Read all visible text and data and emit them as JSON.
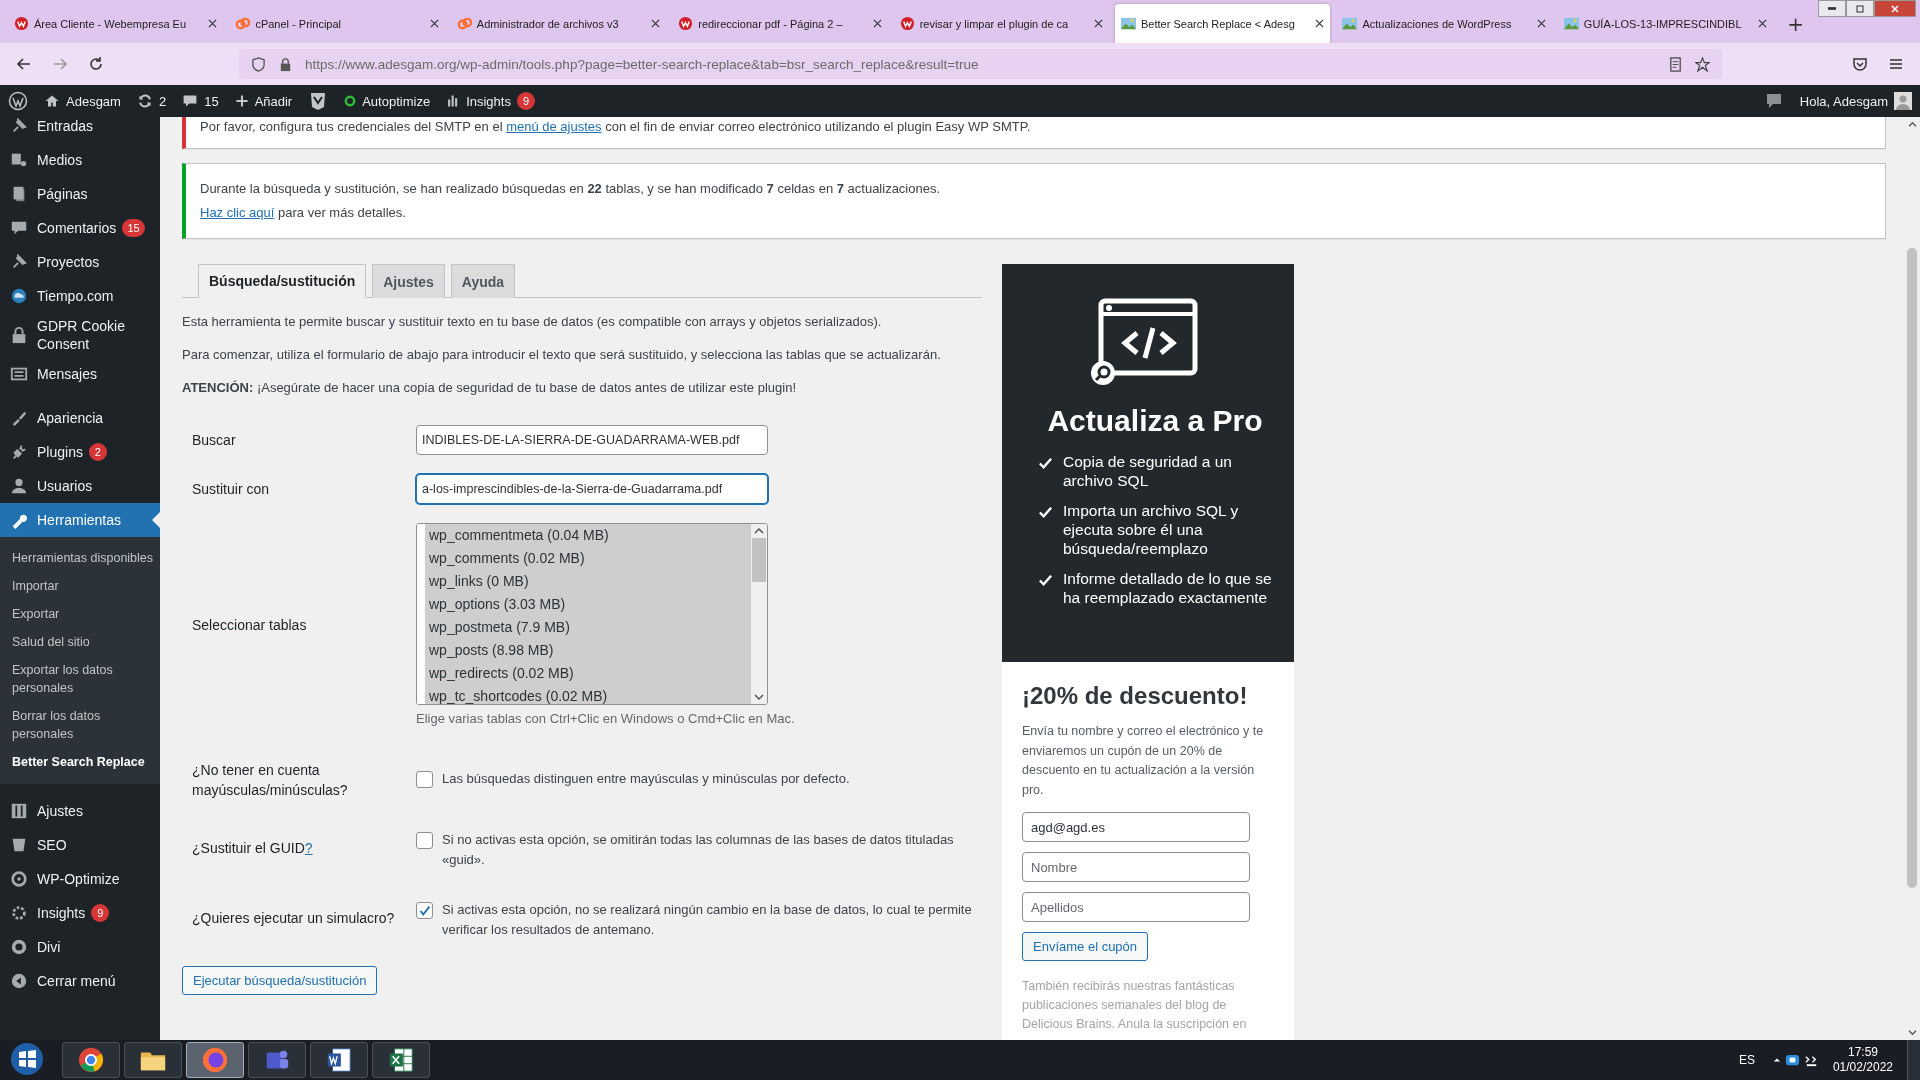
{
  "browser": {
    "tabs": [
      {
        "title": "Área Cliente - Webempresa Eu",
        "kind": "webempresa",
        "selected": false
      },
      {
        "title": "cPanel - Principal",
        "kind": "cpanel",
        "selected": false
      },
      {
        "title": "Administrador de archivos v3",
        "kind": "cpanel",
        "selected": false
      },
      {
        "title": "redireccionar pdf - Página 2 –",
        "kind": "webempresa",
        "selected": false
      },
      {
        "title": "revisar y limpar el plugin de ca",
        "kind": "webempresa",
        "selected": false
      },
      {
        "title": "Better Search Replace < Adesg",
        "kind": "image",
        "selected": true
      },
      {
        "title": "Actualizaciones de WordPress",
        "kind": "image",
        "selected": false
      },
      {
        "title": "GUÍA-LOS-13-IMPRESCINDIBL",
        "kind": "image",
        "selected": false
      }
    ],
    "new_tab": "+",
    "url": "https://www.adesgam.org/wp-admin/tools.php?page=better-search-replace&tab=bsr_search_replace&result=true"
  },
  "admin_bar": {
    "site": "Adesgam",
    "updates": "2",
    "comments": "15",
    "new": "Añadir",
    "autoptimize": "Autoptimize",
    "insights": "Insights",
    "insights_badge": "9",
    "greeting": "Hola, Adesgam"
  },
  "sidebar": {
    "items": [
      {
        "label": "Entradas",
        "selected": false
      },
      {
        "label": "Medios",
        "selected": false
      },
      {
        "label": "Páginas",
        "selected": false
      },
      {
        "label": "Comentarios",
        "badge": "15",
        "selected": false
      },
      {
        "label": "Proyectos",
        "selected": false
      },
      {
        "label": "Tiempo.com",
        "selected": false
      },
      {
        "label": "GDPR Cookie Consent",
        "selected": false
      },
      {
        "label": "Mensajes",
        "selected": false
      },
      {
        "label": "Apariencia",
        "selected": false
      },
      {
        "label": "Plugins",
        "badge": "2",
        "selected": false
      },
      {
        "label": "Usuarios",
        "selected": false
      },
      {
        "label": "Herramientas",
        "selected": true,
        "children": [
          {
            "label": "Herramientas disponibles",
            "selected": false
          },
          {
            "label": "Importar",
            "selected": false
          },
          {
            "label": "Exportar",
            "selected": false
          },
          {
            "label": "Salud del sitio",
            "selected": false
          },
          {
            "label": "Exportar los datos personales",
            "selected": false
          },
          {
            "label": "Borrar los datos personales",
            "selected": false
          },
          {
            "label": "Better Search Replace",
            "selected": true
          }
        ]
      },
      {
        "label": "Ajustes",
        "selected": false
      },
      {
        "label": "SEO",
        "selected": false
      },
      {
        "label": "WP-Optimize",
        "selected": false
      },
      {
        "label": "Insights",
        "badge": "9",
        "selected": false
      },
      {
        "label": "Divi",
        "selected": false
      },
      {
        "label": "Cerrar menú",
        "selected": false
      }
    ]
  },
  "notices": [
    {
      "kind": "error",
      "before": "Por favor, configura tus credenciales del SMTP en el ",
      "link": "menú de ajustes",
      "after": " con el fin de enviar correo electrónico utilizando el plugin Easy WP SMTP."
    },
    {
      "kind": "success",
      "text": "Durante la búsqueda y sustitución, se han realizado búsquedas en **22** tablas, y se han modificado **7** celdas en **7** actualizaciones.",
      "link": "Haz clic aquí",
      "after": " para ver más detalles."
    }
  ],
  "tabs": [
    {
      "label": "Búsqueda/sustitución",
      "selected": true
    },
    {
      "label": "Ajustes",
      "selected": false
    },
    {
      "label": "Ayuda",
      "selected": false
    }
  ],
  "intro": [
    "Esta herramienta te permite buscar y sustituir texto en tu base de datos (es compatible con arrays y objetos serializados).",
    "Para comenzar, utiliza el formulario de abajo para introducir el texto que será sustituido, y selecciona las tablas que se actualizarán.",
    "**ATENCIÓN:** ¡Asegúrate de hacer una copia de seguridad de tu base de datos antes de utilizar este plugin!"
  ],
  "form": {
    "search": {
      "label": "Buscar",
      "value": "INDIBLES-DE-LA-SIERRA-DE-GUADARRAMA-WEB.pdf",
      "focused": false
    },
    "replace": {
      "label": "Sustituir con",
      "value": "a-los-imprescindibles-de-la-Sierra-de-Guadarrama.pdf",
      "focused": true
    },
    "tables": {
      "label": "Seleccionar tablas",
      "options": [
        {
          "label": "wp_commentmeta (0.04 MB)",
          "selected": true
        },
        {
          "label": "wp_comments (0.02 MB)",
          "selected": true
        },
        {
          "label": "wp_links (0 MB)",
          "selected": true
        },
        {
          "label": "wp_options (3.03 MB)",
          "selected": true
        },
        {
          "label": "wp_postmeta (7.9 MB)",
          "selected": true
        },
        {
          "label": "wp_posts (8.98 MB)",
          "selected": true
        },
        {
          "label": "wp_redirects (0.02 MB)",
          "selected": true
        },
        {
          "label": "wp_tc_shortcodes (0.02 MB)",
          "selected": true
        }
      ],
      "hint": "Elige varias tablas con Ctrl+Clic en Windows o Cmd+Clic en Mac."
    },
    "options": [
      {
        "label": "¿No tener en cuenta mayúsculas/minúsculas?",
        "description": "Las búsquedas distinguen entre mayúsculas y minúsculas por defecto.",
        "checked": false
      },
      {
        "label": "¿Sustituir el GUID",
        "help_link": "?",
        "description": "Si no activas esta opción, se omitirán todas las columnas de las bases de datos tituladas «guid».",
        "checked": false
      },
      {
        "label": "¿Quieres ejecutar un simulacro?",
        "description": "Si activas esta opción, no se realizará ningún cambio en la base de datos, lo cual te permite verificar los resultados de antemano.",
        "checked": true
      }
    ],
    "submit": "Ejecutar búsqueda/sustitución"
  },
  "promo": {
    "title": "Actualiza a Pro",
    "features": [
      "Copia de seguridad a un archivo SQL",
      "Importa un archivo SQL y ejecuta sobre él una búsqueda/reemplazo",
      "Informe detallado de lo que se ha reemplazado exactamente"
    ],
    "discount_title": "¡20% de descuento!",
    "discount_text": "Envía tu nombre y correo el electrónico y te enviaremos un cupón de un 20% de descuento en tu actualización a la versión pro.",
    "fields": [
      {
        "value": "agd@agd.es"
      },
      {
        "placeholder": "Nombre"
      },
      {
        "placeholder": "Apellidos"
      }
    ],
    "button": "Envíame el cupón",
    "footer": "También recibirás nuestras fantásticas publicaciones semanales del blog de Delicious Brains. Anula la suscripción en"
  },
  "taskbar": {
    "apps": [
      {
        "kind": "chrome",
        "selected": false
      },
      {
        "kind": "explorer",
        "selected": false
      },
      {
        "kind": "firefox",
        "selected": true
      },
      {
        "kind": "teams",
        "selected": false
      },
      {
        "kind": "word",
        "selected": false
      },
      {
        "kind": "excel",
        "selected": false
      }
    ],
    "language": "ES",
    "time": "17:59",
    "date": "01/02/2022"
  }
}
